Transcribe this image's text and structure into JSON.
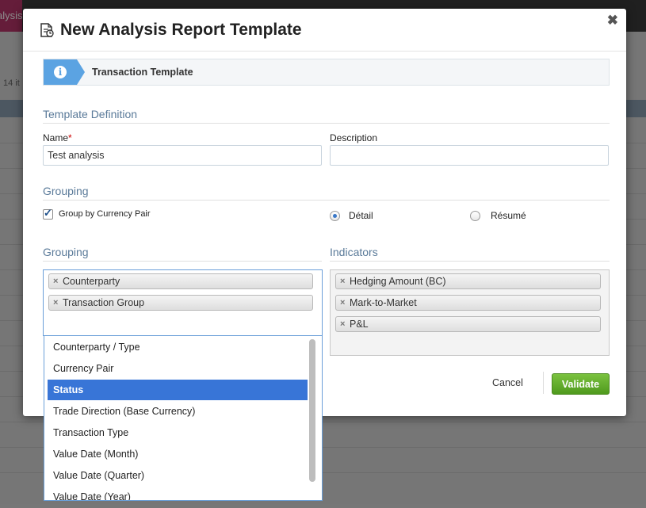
{
  "background": {
    "tab_label": "alysis",
    "count_text": "14 it"
  },
  "modal": {
    "title": "New Analysis Report Template",
    "close": "✖",
    "info_text": "Transaction Template",
    "template_definition": {
      "section_title": "Template Definition",
      "name_label": "Name",
      "name_required": "*",
      "name_value": "Test analysis",
      "description_label": "Description",
      "description_value": ""
    },
    "grouping_options": {
      "section_title": "Grouping",
      "checkbox_label": "Group by Currency Pair",
      "checkbox_checked": true,
      "radio_detail_label": "Détail",
      "radio_resume_label": "Résumé",
      "selected_radio": "detail"
    },
    "grouping": {
      "section_title": "Grouping",
      "tags": [
        "Counterparty",
        "Transaction Group"
      ]
    },
    "indicators": {
      "section_title": "Indicators",
      "tags": [
        "Hedging Amount (BC)",
        "Mark-to-Market",
        "P&L"
      ]
    },
    "footer": {
      "cancel_label": "Cancel",
      "validate_label": "Validate"
    }
  },
  "dropdown": {
    "items": [
      "Counterparty / Type",
      "Currency Pair",
      "Status",
      "Trade Direction (Base Currency)",
      "Transaction Type",
      "Value Date (Month)",
      "Value Date (Quarter)",
      "Value Date (Year)"
    ],
    "selected": "Status"
  },
  "colors": {
    "accent": "#3875d7",
    "info": "#5ba3e2",
    "validate": "#5fa82a"
  }
}
